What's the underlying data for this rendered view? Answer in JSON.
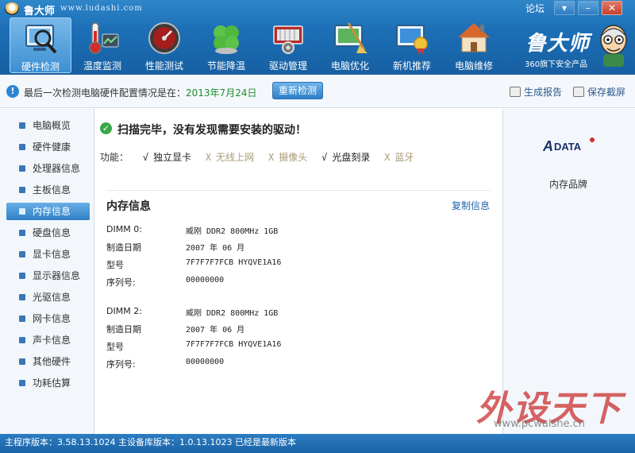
{
  "app": {
    "name": "鲁大师",
    "url": "www.ludashi.com"
  },
  "window": {
    "forum": "论坛",
    "menu_icon": "menu-down-icon",
    "min_icon": "minimize-icon",
    "close_icon": "close-icon"
  },
  "toolbar": [
    {
      "label": "硬件检测",
      "icon": "hardware-check-icon"
    },
    {
      "label": "温度监测",
      "icon": "thermometer-icon"
    },
    {
      "label": "性能测试",
      "icon": "speedometer-icon"
    },
    {
      "label": "节能降温",
      "icon": "clover-icon"
    },
    {
      "label": "驱动管理",
      "icon": "driver-gear-icon"
    },
    {
      "label": "电脑优化",
      "icon": "broom-monitor-icon"
    },
    {
      "label": "新机推荐",
      "icon": "monitor-medal-icon"
    },
    {
      "label": "电脑维修",
      "icon": "house-wrench-icon"
    }
  ],
  "brand": {
    "name": "鲁大师",
    "sub": "360旗下安全产品"
  },
  "infobar": {
    "prefix": "最后一次检测电脑硬件配置情况是在：",
    "date": "2013年7月24日",
    "recheck": "重新检测",
    "report": "生成报告",
    "screenshot": "保存截屏"
  },
  "sidebar": {
    "items": [
      {
        "label": "电脑概览"
      },
      {
        "label": "硬件健康"
      },
      {
        "label": "处理器信息"
      },
      {
        "label": "主板信息"
      },
      {
        "label": "内存信息"
      },
      {
        "label": "硬盘信息"
      },
      {
        "label": "显卡信息"
      },
      {
        "label": "显示器信息"
      },
      {
        "label": "光驱信息"
      },
      {
        "label": "网卡信息"
      },
      {
        "label": "声卡信息"
      },
      {
        "label": "其他硬件"
      },
      {
        "label": "功耗估算"
      }
    ],
    "active": 4
  },
  "main": {
    "scan_result": "扫描完毕，没有发现需要安装的驱动！",
    "func_label": "功能：",
    "features": [
      {
        "mark": "√",
        "name": "独立显卡",
        "on": true
      },
      {
        "mark": "X",
        "name": "无线上网",
        "on": false
      },
      {
        "mark": "X",
        "name": "摄像头",
        "on": false
      },
      {
        "mark": "√",
        "name": "光盘刻录",
        "on": true
      },
      {
        "mark": "X",
        "name": "蓝牙",
        "on": false
      }
    ],
    "section_title": "内存信息",
    "copy": "复制信息",
    "modules": [
      {
        "rows": [
          {
            "k": "DIMM 0:",
            "v": "威刚 DDR2 800MHz 1GB"
          },
          {
            "k": "制造日期",
            "v": "2007 年 06 月"
          },
          {
            "k": "型号",
            "v": "7F7F7F7FCB HYQVE1A16"
          },
          {
            "k": "序列号:",
            "v": "00000000"
          }
        ]
      },
      {
        "rows": [
          {
            "k": "DIMM 2:",
            "v": "威刚 DDR2 800MHz 1GB"
          },
          {
            "k": "制造日期",
            "v": "2007 年 06 月"
          },
          {
            "k": "型号",
            "v": "7F7F7F7FCB HYQVE1A16"
          },
          {
            "k": "序列号:",
            "v": "00000000"
          }
        ]
      }
    ]
  },
  "right": {
    "logo_text": "A-DATA",
    "label": "内存品牌"
  },
  "watermark": {
    "big": "外设天下",
    "small": "www.pcwaishe.cn"
  },
  "status": {
    "text": "主程序版本：3.58.13.1024  主设备库版本：1.0.13.1023  已经是最新版本"
  },
  "colors": {
    "accent": "#1c6fb6",
    "active": "#2f80c6",
    "date_green": "#1f8c2f",
    "link": "#2466a8"
  }
}
